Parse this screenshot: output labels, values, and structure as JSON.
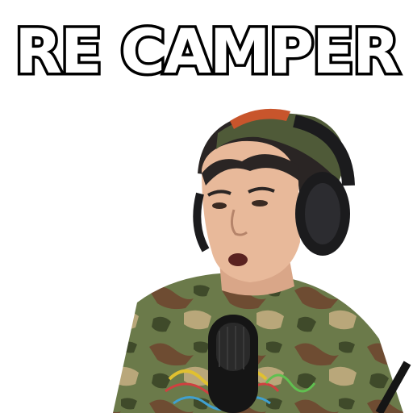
{
  "caption": "RE CAMPER",
  "colors": {
    "background": "#ffffff",
    "caption_fill": "#ffffff",
    "caption_outline": "#000000",
    "skin": "#e8b99a",
    "hair": "#2a2524",
    "bandana_green": "#4f5a38",
    "bandana_orange": "#c8552c",
    "headphones": "#1b1b1d",
    "camo_green": "#6b7a4a",
    "camo_brown": "#6e4c32",
    "camo_tan": "#b9a77a",
    "microphone": "#151515"
  },
  "icons": {
    "subject": "person-with-headphones",
    "microphone": "microphone-icon"
  }
}
